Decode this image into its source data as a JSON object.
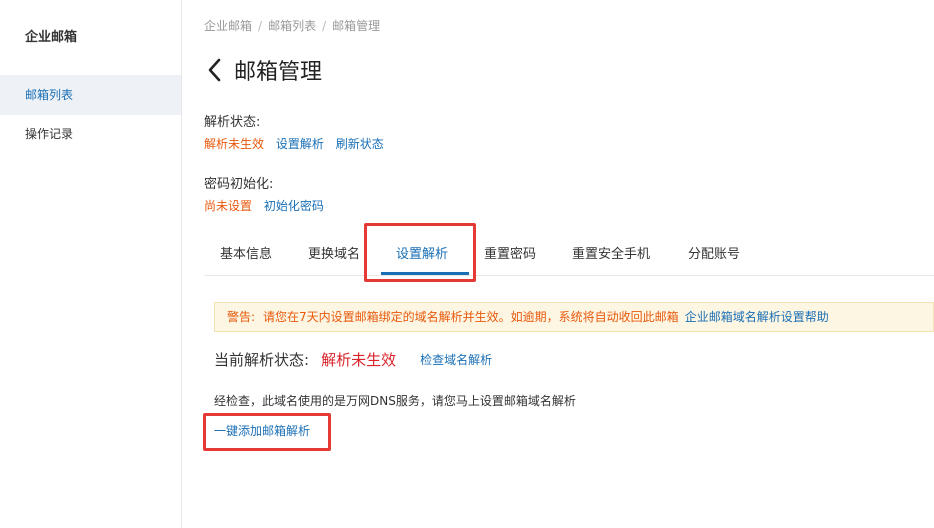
{
  "sidebar": {
    "brand": "企业邮箱",
    "items": [
      {
        "label": "邮箱列表",
        "active": true
      },
      {
        "label": "操作记录",
        "active": false
      }
    ]
  },
  "breadcrumb": [
    "企业邮箱",
    "邮箱列表",
    "邮箱管理"
  ],
  "breadcrumb_separator": "/",
  "page": {
    "title": "邮箱管理",
    "back_icon": "chevron-left-icon"
  },
  "resolve_status": {
    "label": "解析状态:",
    "value": "解析未生效",
    "actions": [
      "设置解析",
      "刷新状态"
    ]
  },
  "password_init": {
    "label": "密码初始化:",
    "value": "尚未设置",
    "action": "初始化密码"
  },
  "tabs": [
    {
      "label": "基本信息",
      "active": false
    },
    {
      "label": "更换域名",
      "active": false
    },
    {
      "label": "设置解析",
      "active": true
    },
    {
      "label": "重置密码",
      "active": false
    },
    {
      "label": "重置安全手机",
      "active": false
    },
    {
      "label": "分配账号",
      "active": false
    }
  ],
  "alert": {
    "label": "警告:",
    "text": "请您在7天内设置邮箱绑定的域名解析并生效。如逾期，系统将自动收回此邮箱",
    "help_link": "企业邮箱域名解析设置帮助"
  },
  "current_status": {
    "label": "当前解析状态:",
    "value": "解析未生效",
    "check_link": "检查域名解析"
  },
  "check_message": "经检查，此域名使用的是万网DNS服务，请您马上设置邮箱域名解析",
  "add_link": "一键添加邮箱解析",
  "colors": {
    "accent": "#1a6fb5",
    "warning": "#e8590c",
    "error": "#d9242b",
    "highlight_box": "#e53935"
  }
}
